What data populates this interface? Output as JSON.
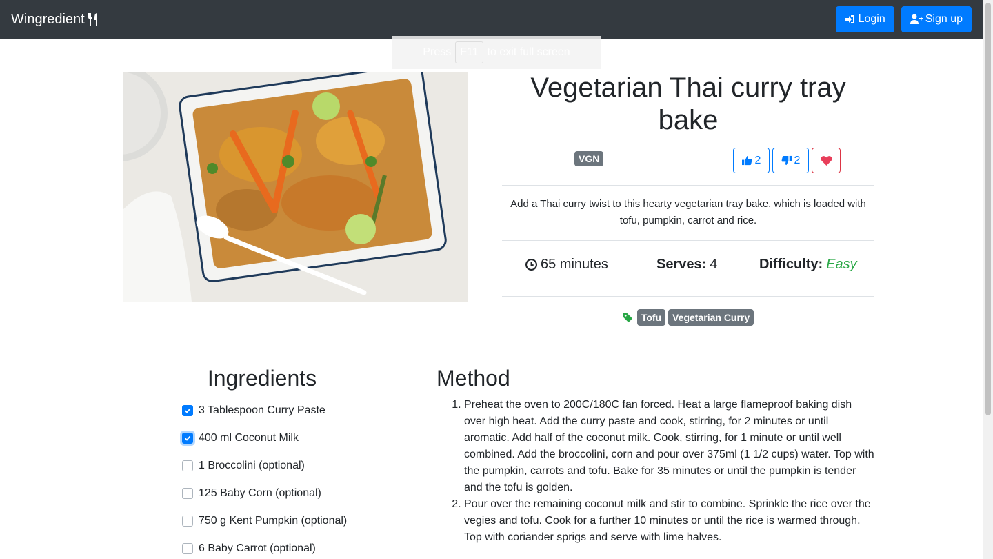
{
  "navbar": {
    "brand": "Wingredient",
    "brand_icon": "utensils-icon",
    "login_label": "Login",
    "signup_label": "Sign up"
  },
  "fullscreen_toast": {
    "prefix": "Press",
    "key": "F11",
    "suffix": "to exit full screen"
  },
  "recipe": {
    "title": "Vegetarian Thai curry tray bake",
    "diet_badge": "VGN",
    "likes": "2",
    "dislikes": "2",
    "description": "Add a Thai curry twist to this hearty vegetarian tray bake, which is loaded with tofu, pumpkin, carrot and rice.",
    "time": "65 minutes",
    "serves_label": "Serves:",
    "serves": "4",
    "difficulty_label": "Difficulty:",
    "difficulty": "Easy",
    "tags": [
      "Tofu",
      "Vegetarian Curry"
    ]
  },
  "ingredients": {
    "heading": "Ingredients",
    "items": [
      {
        "label": "3 Tablespoon Curry Paste",
        "checked": true
      },
      {
        "label": "400 ml Coconut Milk",
        "checked": true
      },
      {
        "label": "1 Broccolini (optional)",
        "checked": false
      },
      {
        "label": "125 Baby Corn (optional)",
        "checked": false
      },
      {
        "label": "750 g Kent Pumpkin (optional)",
        "checked": false
      },
      {
        "label": "6 Baby Carrot (optional)",
        "checked": false
      }
    ]
  },
  "method": {
    "heading": "Method",
    "steps": [
      "Preheat the oven to 200C/180C fan forced. Heat a large flameproof baking dish over high heat. Add the curry paste and cook, stirring, for 2 minutes or until aromatic. Add half of the coconut milk. Cook, stirring, for 1 minute or until well combined. Add the broccolini, corn and pour over 375ml (1 1/2 cups) water. Top with the pumpkin, carrots and tofu. Bake for 35 minutes or until the pumpkin is tender and the tofu is golden.",
      "Pour over the remaining coconut milk and stir to combine. Sprinkle the rice over the vegies and tofu. Cook for a further 10 minutes or until the rice is warmed through. Top with coriander sprigs and serve with lime halves."
    ]
  },
  "colors": {
    "navbar": "#343a40",
    "primary": "#007bff",
    "success": "#28a745",
    "danger": "#dc3545",
    "badge": "#6c757d"
  }
}
